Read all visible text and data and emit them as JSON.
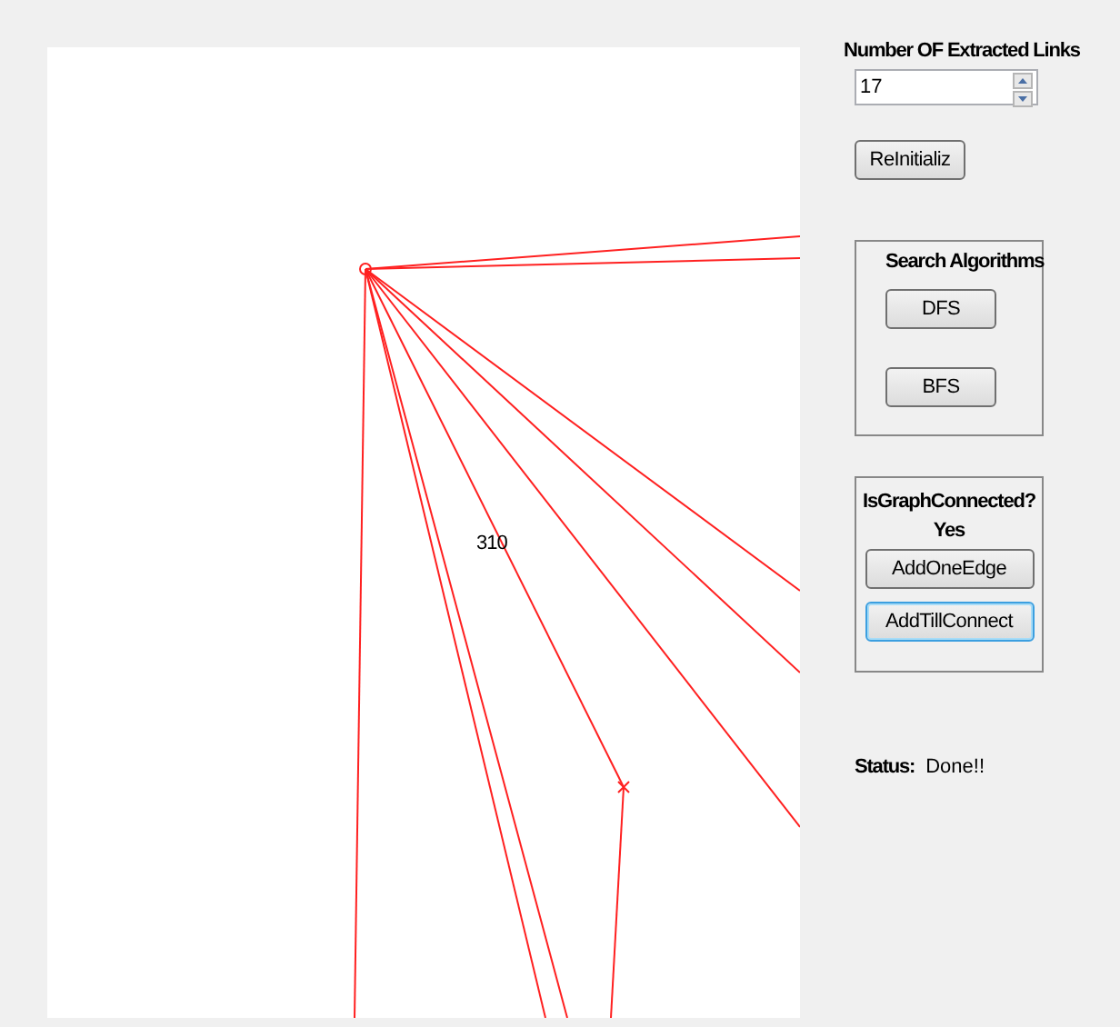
{
  "canvas": {
    "node_labels": [
      "310"
    ]
  },
  "links": {
    "label": "Number OF Extracted Links",
    "value": "17"
  },
  "reinit_button": {
    "label": "ReInitializ"
  },
  "search_group": {
    "title": "Search Algorithms",
    "buttons": [
      {
        "label": "DFS",
        "focused": false
      },
      {
        "label": "BFS",
        "focused": false
      }
    ]
  },
  "connect_group": {
    "title": "IsGraphConnected?",
    "answer": "Yes",
    "buttons": [
      {
        "label": "AddOneEdge",
        "focused": false
      },
      {
        "label": "AddTillConnect",
        "focused": true
      }
    ]
  },
  "status": {
    "label": "Status:",
    "value": "Done!!"
  }
}
